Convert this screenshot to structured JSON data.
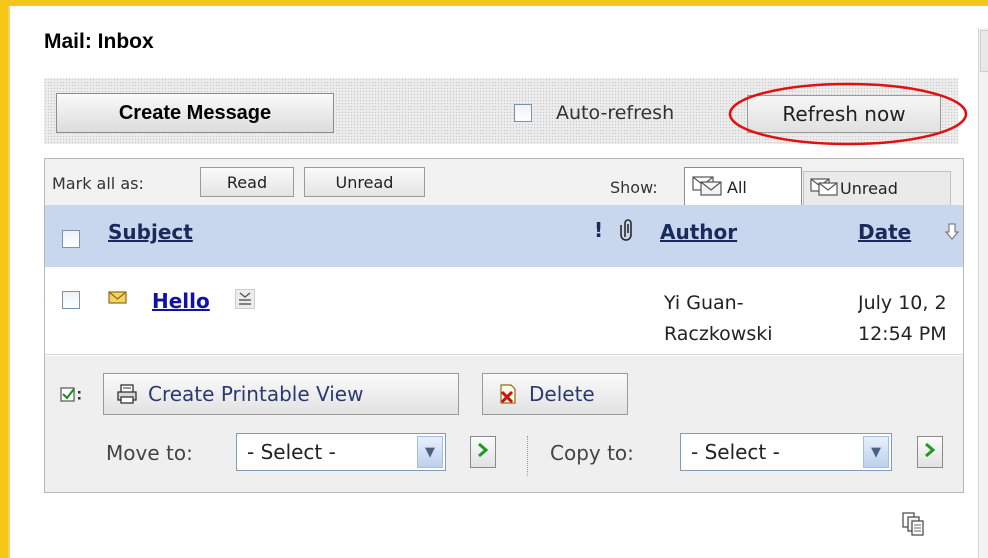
{
  "page": {
    "title": "Mail: Inbox"
  },
  "toolbar": {
    "create_label": "Create Message",
    "auto_refresh_label": "Auto-refresh",
    "auto_refresh_checked": false,
    "refresh_label": "Refresh now"
  },
  "markbar": {
    "mark_all_label": "Mark all as:",
    "read_label": "Read",
    "unread_label": "Unread",
    "show_label": "Show:",
    "show_all_label": "All",
    "show_unread_label": "Unread",
    "active_filter": "All"
  },
  "table": {
    "headers": {
      "subject": "Subject",
      "flag": "!",
      "author": "Author",
      "date": "Date"
    },
    "sort": {
      "column": "Date",
      "direction": "descending"
    },
    "rows": [
      {
        "subject": "Hello",
        "author_line1": "Yi Guan-",
        "author_line2": "Raczkowski",
        "date_line1": "July 10, 2",
        "date_line2": "12:54 PM",
        "read": false,
        "selected": false
      }
    ]
  },
  "actions": {
    "printable_label": "Create Printable View",
    "delete_label": "Delete",
    "move_label": "Move to:",
    "move_value": "- Select -",
    "copy_label": "Copy to:",
    "copy_value": "- Select -"
  },
  "colors": {
    "frame": "#f5c518",
    "header_bg": "#c8d7ed",
    "link": "#1111aa",
    "highlight_ellipse": "#e01010",
    "go_arrow": "#1f9a1f"
  }
}
